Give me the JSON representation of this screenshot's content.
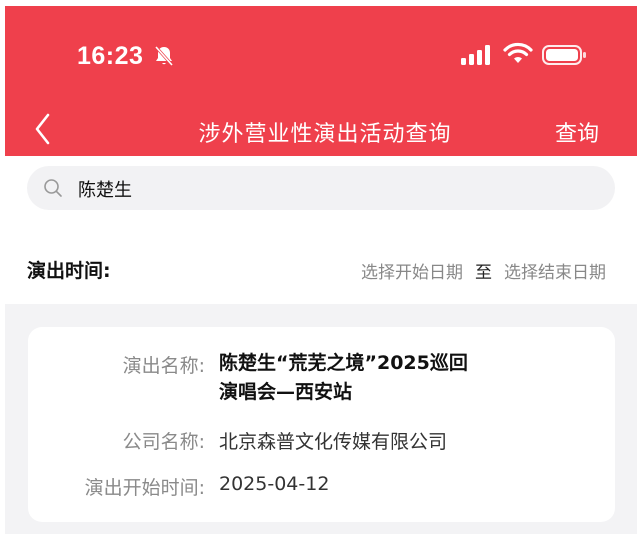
{
  "status_bar": {
    "time": "16:23"
  },
  "nav": {
    "title": "涉外营业性演出活动查询",
    "query_label": "查询"
  },
  "search": {
    "value": "陈楚生"
  },
  "filter": {
    "label": "演出时间:",
    "start_placeholder": "选择开始日期",
    "separator": "至",
    "end_placeholder": "选择结束日期"
  },
  "result": {
    "name_label": "演出名称:",
    "name_line1": "陈楚生“荒芜之境”2025巡回",
    "name_line2": "演唱会—西安站",
    "company_label": "公司名称:",
    "company_value": "北京森普文化传媒有限公司",
    "start_label": "演出开始时间:",
    "start_value": "2025-04-12"
  },
  "colors": {
    "accent": "#ef404c",
    "background": "#f3f3f5"
  }
}
